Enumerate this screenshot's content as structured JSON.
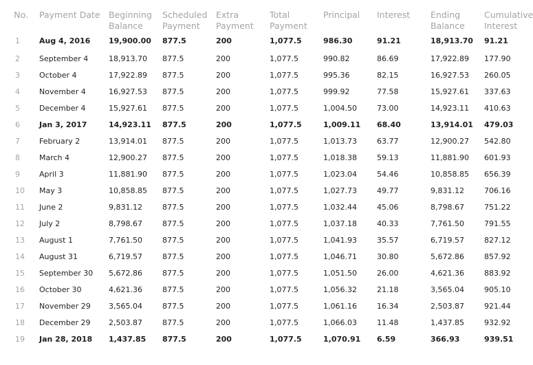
{
  "table": {
    "headers": [
      "No.",
      "Payment Date",
      "Beginning\nBalance",
      "Scheduled\nPayment",
      "Extra\nPayment",
      "Total\nPayment",
      "Principal",
      "Interest",
      "Ending\nBalance",
      "Cumulative\nInterest"
    ],
    "rows": [
      {
        "bold": true,
        "cells": [
          "1",
          "Aug 4, 2016",
          "19,900.00",
          "877.5",
          "200",
          "1,077.5",
          "986.30",
          "91.21",
          "18,913.70",
          "91.21"
        ]
      },
      {
        "bold": false,
        "cells": [
          "2",
          "September 4",
          "18,913.70",
          "877.5",
          "200",
          "1,077.5",
          "990.82",
          "86.69",
          "17,922.89",
          "177.90"
        ]
      },
      {
        "bold": false,
        "cells": [
          "3",
          "October 4",
          "17,922.89",
          "877.5",
          "200",
          "1,077.5",
          "995.36",
          "82.15",
          "16,927.53",
          "260.05"
        ]
      },
      {
        "bold": false,
        "cells": [
          "4",
          "November 4",
          "16,927.53",
          "877.5",
          "200",
          "1,077.5",
          "999.92",
          "77.58",
          "15,927.61",
          "337.63"
        ]
      },
      {
        "bold": false,
        "cells": [
          "5",
          "December 4",
          "15,927.61",
          "877.5",
          "200",
          "1,077.5",
          "1,004.50",
          "73.00",
          "14,923.11",
          "410.63"
        ]
      },
      {
        "bold": true,
        "cells": [
          "6",
          "Jan 3, 2017",
          "14,923.11",
          "877.5",
          "200",
          "1,077.5",
          "1,009.11",
          "68.40",
          "13,914.01",
          "479.03"
        ]
      },
      {
        "bold": false,
        "cells": [
          "7",
          "February 2",
          "13,914.01",
          "877.5",
          "200",
          "1,077.5",
          "1,013.73",
          "63.77",
          "12,900.27",
          "542.80"
        ]
      },
      {
        "bold": false,
        "cells": [
          "8",
          "March 4",
          "12,900.27",
          "877.5",
          "200",
          "1,077.5",
          "1,018.38",
          "59.13",
          "11,881.90",
          "601.93"
        ]
      },
      {
        "bold": false,
        "cells": [
          "9",
          "April 3",
          "11,881.90",
          "877.5",
          "200",
          "1,077.5",
          "1,023.04",
          "54.46",
          "10,858.85",
          "656.39"
        ]
      },
      {
        "bold": false,
        "cells": [
          "10",
          "May 3",
          "10,858.85",
          "877.5",
          "200",
          "1,077.5",
          "1,027.73",
          "49.77",
          "9,831.12",
          "706.16"
        ]
      },
      {
        "bold": false,
        "cells": [
          "11",
          "June 2",
          "9,831.12",
          "877.5",
          "200",
          "1,077.5",
          "1,032.44",
          "45.06",
          "8,798.67",
          "751.22"
        ]
      },
      {
        "bold": false,
        "cells": [
          "12",
          "July 2",
          "8,798.67",
          "877.5",
          "200",
          "1,077.5",
          "1,037.18",
          "40.33",
          "7,761.50",
          "791.55"
        ]
      },
      {
        "bold": false,
        "cells": [
          "13",
          "August 1",
          "7,761.50",
          "877.5",
          "200",
          "1,077.5",
          "1,041.93",
          "35.57",
          "6,719.57",
          "827.12"
        ]
      },
      {
        "bold": false,
        "cells": [
          "14",
          "August 31",
          "6,719.57",
          "877.5",
          "200",
          "1,077.5",
          "1,046.71",
          "30.80",
          "5,672.86",
          "857.92"
        ]
      },
      {
        "bold": false,
        "cells": [
          "15",
          "September 30",
          "5,672.86",
          "877.5",
          "200",
          "1,077.5",
          "1,051.50",
          "26.00",
          "4,621.36",
          "883.92"
        ]
      },
      {
        "bold": false,
        "cells": [
          "16",
          "October 30",
          "4,621.36",
          "877.5",
          "200",
          "1,077.5",
          "1,056.32",
          "21.18",
          "3,565.04",
          "905.10"
        ]
      },
      {
        "bold": false,
        "cells": [
          "17",
          "November 29",
          "3,565.04",
          "877.5",
          "200",
          "1,077.5",
          "1,061.16",
          "16.34",
          "2,503.87",
          "921.44"
        ]
      },
      {
        "bold": false,
        "cells": [
          "18",
          "December 29",
          "2,503.87",
          "877.5",
          "200",
          "1,077.5",
          "1,066.03",
          "11.48",
          "1,437.85",
          "932.92"
        ]
      },
      {
        "bold": true,
        "cells": [
          "19",
          "Jan 28, 2018",
          "1,437.85",
          "877.5",
          "200",
          "1,077.5",
          "1,070.91",
          "6.59",
          "366.93",
          "939.51"
        ]
      }
    ]
  }
}
